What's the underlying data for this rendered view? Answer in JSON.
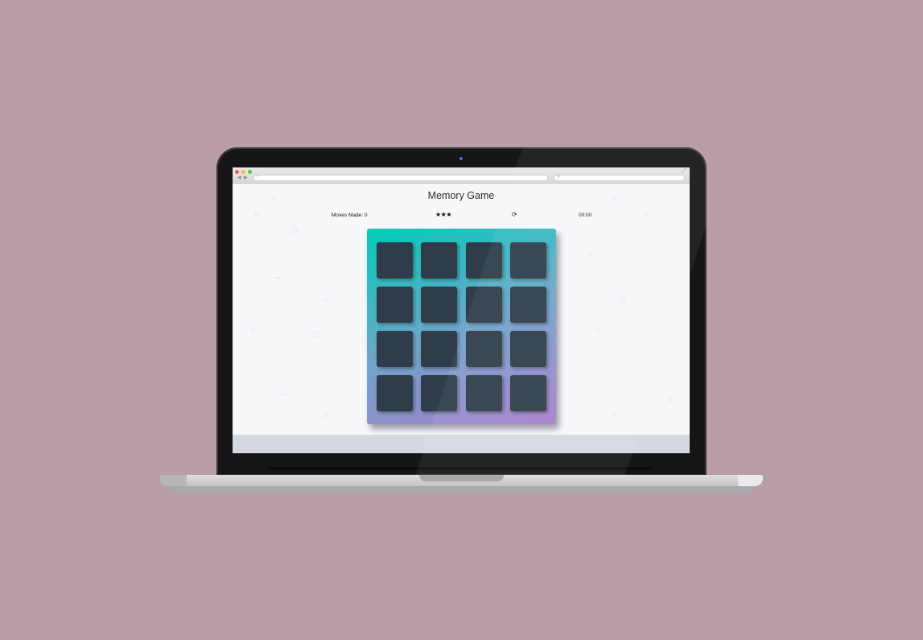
{
  "game": {
    "title": "Memory Game",
    "moves_label": "Moves Made: 0",
    "moves": 0,
    "stars": "★★★",
    "star_rating": 3,
    "restart_icon": "restart-icon",
    "restart_glyph": "⟳",
    "timer": "00:00",
    "grid": {
      "rows": 4,
      "cols": 4,
      "cards_face_down": 16
    }
  },
  "colors": {
    "background": "#b99ea5",
    "card_back": "#2e3d49",
    "deck_gradient_start": "#02ccba",
    "deck_gradient_end": "#aa7ecd"
  }
}
